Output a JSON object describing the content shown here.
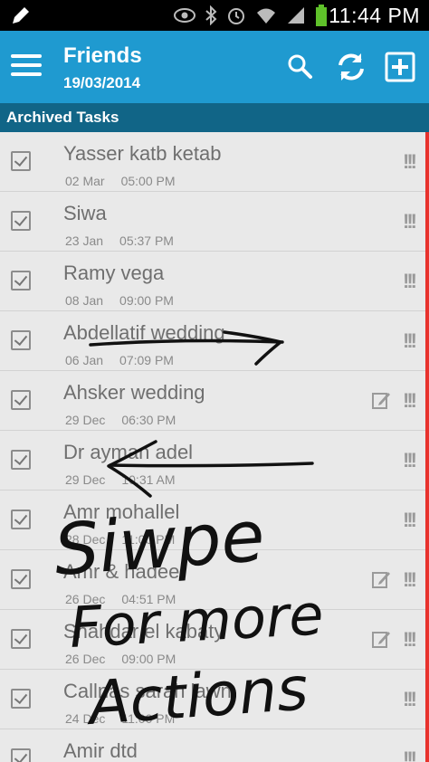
{
  "statusbar": {
    "time": "11:44 PM"
  },
  "header": {
    "title": "Friends",
    "date": "19/03/2014"
  },
  "section": {
    "title": "Archived Tasks"
  },
  "tasks": [
    {
      "name": "Yasser katb ketab",
      "date": "02 Mar",
      "time": "05:00 PM",
      "has_note": false
    },
    {
      "name": "Siwa",
      "date": "23 Jan",
      "time": "05:37 PM",
      "has_note": false
    },
    {
      "name": "Ramy vega",
      "date": "08 Jan",
      "time": "09:00 PM",
      "has_note": false
    },
    {
      "name": "Abdellatif wedding",
      "date": "06 Jan",
      "time": "07:09 PM",
      "has_note": false
    },
    {
      "name": "Ahsker wedding",
      "date": "29 Dec",
      "time": "06:30 PM",
      "has_note": true
    },
    {
      "name": "Dr ayman adel",
      "date": "29 Dec",
      "time": "10:31 AM",
      "has_note": false
    },
    {
      "name": "Amr mohallel",
      "date": "28 Dec",
      "time": "11:00 PM",
      "has_note": false
    },
    {
      "name": "Amr & hadeer",
      "date": "26 Dec",
      "time": "04:51 PM",
      "has_note": true
    },
    {
      "name": "Shahdar el kabaty",
      "date": "26 Dec",
      "time": "09:00 PM",
      "has_note": true
    },
    {
      "name": "Callnas sarah lawn",
      "date": "24 Dec",
      "time": "11:00 PM",
      "has_note": false
    },
    {
      "name": "Amir dtd",
      "date": "",
      "time": "",
      "has_note": false
    }
  ],
  "priority_mark": "!!!",
  "annotation": {
    "line1": "Siwpe",
    "line2": "For more",
    "line3": "Actions"
  },
  "colors": {
    "appbar": "#1f9ad0",
    "section": "#116587",
    "accent_bar": "#e8322d"
  }
}
